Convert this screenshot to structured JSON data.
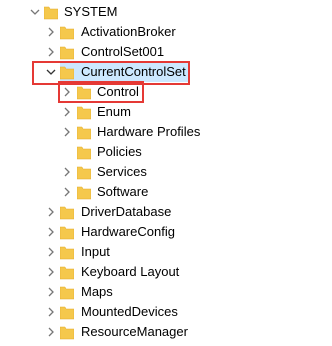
{
  "tree": {
    "items": [
      {
        "label": "SYSTEM",
        "expanded": true
      },
      {
        "label": "ActivationBroker",
        "expanded": false
      },
      {
        "label": "ControlSet001",
        "expanded": false
      },
      {
        "label": "CurrentControlSet",
        "expanded": true,
        "selected": true
      },
      {
        "label": "Control",
        "expanded": false,
        "highlighted": true
      },
      {
        "label": "Enum",
        "expanded": false
      },
      {
        "label": "Hardware Profiles",
        "expanded": false
      },
      {
        "label": "Policies",
        "expanded": false
      },
      {
        "label": "Services",
        "expanded": false
      },
      {
        "label": "Software",
        "expanded": false
      },
      {
        "label": "DriverDatabase",
        "expanded": false
      },
      {
        "label": "HardwareConfig",
        "expanded": false
      },
      {
        "label": "Input",
        "expanded": false
      },
      {
        "label": "Keyboard Layout",
        "expanded": false
      },
      {
        "label": "Maps",
        "expanded": false
      },
      {
        "label": "MountedDevices",
        "expanded": false
      },
      {
        "label": "ResourceManager",
        "expanded": false
      }
    ]
  },
  "colors": {
    "folder": "#f5c84c",
    "folder_dark": "#e1a92a",
    "selection": "#cce8ff",
    "highlight_box": "#e53935",
    "chevron": "#777777"
  },
  "icons": {
    "expanded": "chevron-down-icon",
    "collapsed": "chevron-right-icon",
    "folder": "folder-icon"
  }
}
